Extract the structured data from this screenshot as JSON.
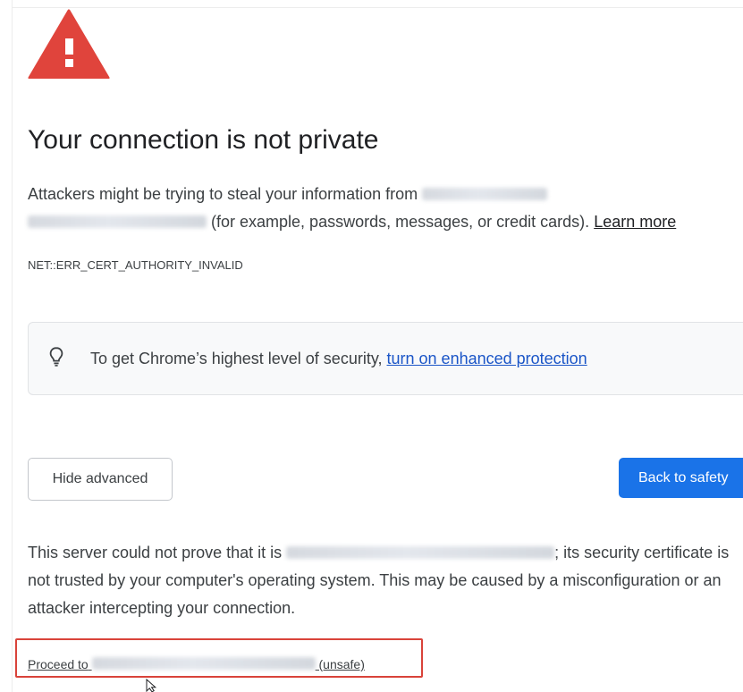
{
  "title": "Your connection is not private",
  "intro": {
    "before": "Attackers might be trying to steal your information from",
    "after": "(for example, passwords, messages, or credit cards).",
    "learn_more": "Learn more"
  },
  "error_code": "NET::ERR_CERT_AUTHORITY_INVALID",
  "promo": {
    "text": "To get Chrome’s highest level of security,",
    "link": "turn on enhanced protection",
    "icon": "lightbulb-icon"
  },
  "buttons": {
    "hide_advanced": "Hide advanced",
    "back_to_safety": "Back to safety"
  },
  "details": {
    "before": "This server could not prove that it is",
    "after": "; its security certificate is not trusted by your computer's operating system. This may be caused by a misconfiguration or an attacker intercepting your connection."
  },
  "proceed": {
    "prefix": "Proceed to",
    "suffix": "(unsafe)"
  },
  "colors": {
    "warning_red": "#e0443c",
    "primary_blue": "#1a73e8",
    "link_blue": "#1a55c7",
    "highlight_box": "#d9433a"
  },
  "icons": {
    "warning": "warning-triangle-icon",
    "pointer": "mouse-pointer-icon"
  }
}
